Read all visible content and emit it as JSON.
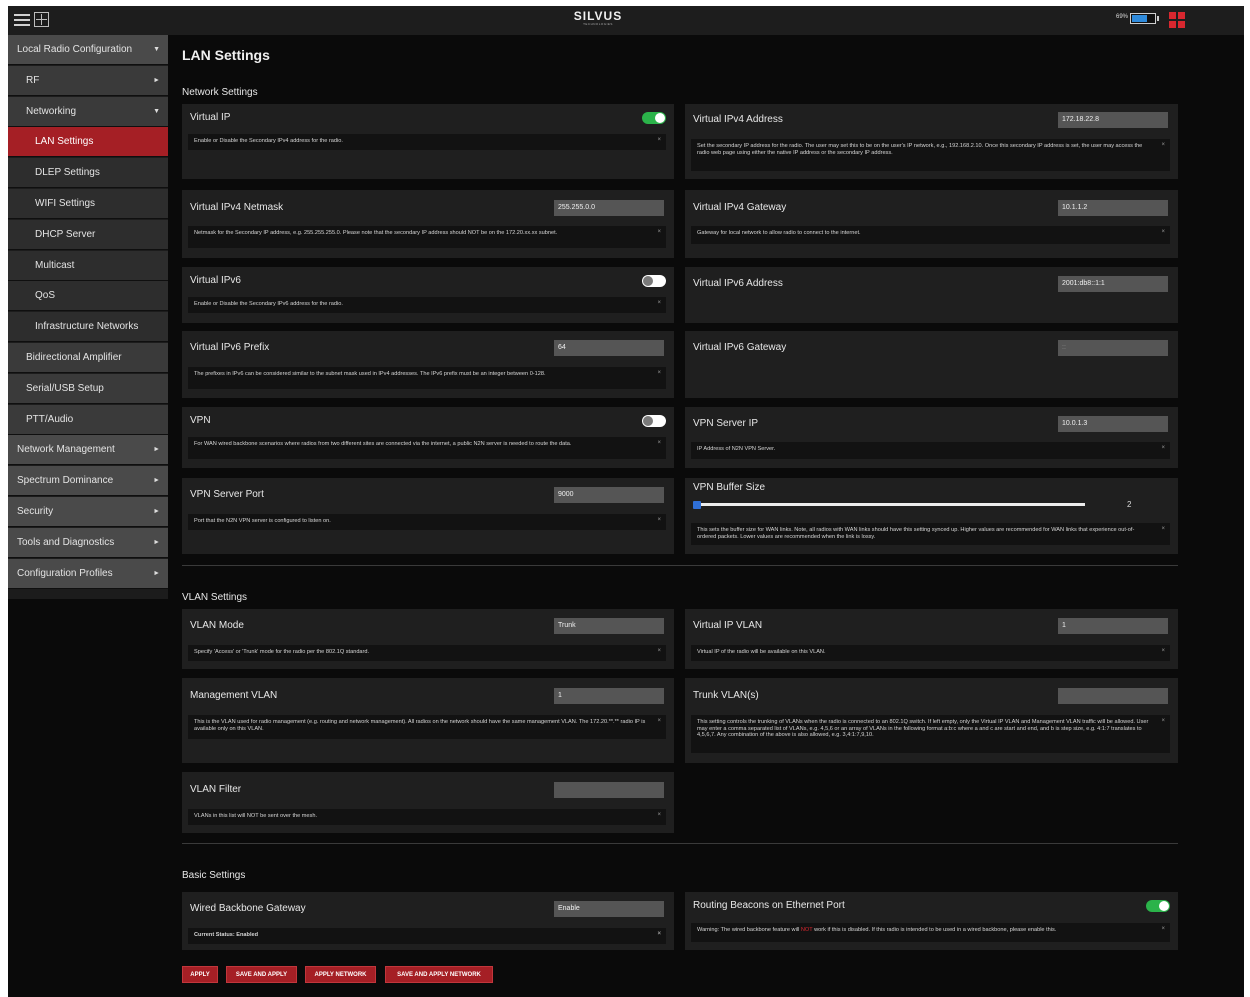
{
  "header": {
    "logo_line1": "SILVUS",
    "logo_line2": "TECHNOLOGIES",
    "battery_percent_label": "69%",
    "battery_level": 0.69,
    "icons": [
      "menu-icon",
      "add-window-icon",
      "battery-icon",
      "grid-icon"
    ]
  },
  "colors": {
    "accent": "#a51f25",
    "toggle_on": "#2bb34a",
    "slider": "#2f6fd6"
  },
  "sidebar": {
    "items": [
      {
        "label": "Local Radio Configuration",
        "level": 0,
        "arrow": "▼"
      },
      {
        "label": "RF",
        "level": 1,
        "arrow": "►"
      },
      {
        "label": "Networking",
        "level": 1,
        "arrow": "▼"
      },
      {
        "label": "LAN Settings",
        "level": 2,
        "active": true
      },
      {
        "label": "DLEP Settings",
        "level": 2
      },
      {
        "label": "WIFI Settings",
        "level": 2
      },
      {
        "label": "DHCP Server",
        "level": 2
      },
      {
        "label": "Multicast",
        "level": 2
      },
      {
        "label": "QoS",
        "level": 2
      },
      {
        "label": "Infrastructure Networks",
        "level": 2
      },
      {
        "label": "Bidirectional Amplifier",
        "level": 1
      },
      {
        "label": "Serial/USB Setup",
        "level": 1
      },
      {
        "label": "PTT/Audio",
        "level": 1
      },
      {
        "label": "Network Management",
        "level": 0,
        "arrow": "►"
      },
      {
        "label": "Spectrum Dominance",
        "level": 0,
        "arrow": "►"
      },
      {
        "label": "Security",
        "level": 0,
        "arrow": "►"
      },
      {
        "label": "Tools and Diagnostics",
        "level": 0,
        "arrow": "►"
      },
      {
        "label": "Configuration Profiles",
        "level": 0,
        "arrow": "►"
      }
    ]
  },
  "page": {
    "title": "LAN Settings",
    "sections": {
      "network": "Network Settings",
      "vlan": "VLAN Settings",
      "basic": "Basic Settings"
    }
  },
  "cards": {
    "virtual_ip": {
      "title": "Virtual IP",
      "toggle_on": true,
      "desc": "Enable or Disable the Secondary IPv4 address for the radio."
    },
    "virtual_ipv4_address": {
      "title": "Virtual IPv4 Address",
      "value": "172.18.22.8",
      "desc": "Set the secondary IP address for the radio. The user may set this to be on the user's IP network, e.g., 192.168.2.10. Once this secondary IP address is set, the user may access the radio web page using either the native IP address or the secondary IP address."
    },
    "virtual_ipv4_netmask": {
      "title": "Virtual IPv4 Netmask",
      "value": "255.255.0.0",
      "desc": "Netmask for the Secondary IP address, e.g. 255.255.255.0. Please note that the secondary IP address should NOT be on the 172.20.xx.xx subnet."
    },
    "virtual_ipv4_gateway": {
      "title": "Virtual IPv4 Gateway",
      "value": "10.1.1.2",
      "desc": "Gateway for local network to allow radio to connect to the internet."
    },
    "virtual_ipv6": {
      "title": "Virtual IPv6",
      "toggle_on": false,
      "desc": "Enable or Disable the Secondary IPv6 address for the radio."
    },
    "virtual_ipv6_address": {
      "title": "Virtual IPv6 Address",
      "value": "2001:db8::1:1"
    },
    "virtual_ipv6_prefix": {
      "title": "Virtual IPv6 Prefix",
      "value": "64",
      "desc": "The prefixes in IPv6 can be considered similar to the subnet mask used in IPv4 addresses. The IPv6 prefix must be an integer between 0-128."
    },
    "virtual_ipv6_gateway": {
      "title": "Virtual IPv6 Gateway",
      "value": "::"
    },
    "vpn": {
      "title": "VPN",
      "toggle_on": false,
      "desc": "For WAN wired backbone scenarios where radios from two different sites are connected via the internet, a public N2N server is needed to route the data."
    },
    "vpn_server_ip": {
      "title": "VPN Server IP",
      "value": "10.0.1.3",
      "desc": "IP Address of N2N VPN Server."
    },
    "vpn_server_port": {
      "title": "VPN Server Port",
      "value": "9000",
      "desc": "Port that the N2N VPN server is configured to listen on."
    },
    "vpn_buffer_size": {
      "title": "VPN Buffer Size",
      "value": "2",
      "slider_fraction": 0.0,
      "desc": "This sets the buffer size for WAN links. Note, all radios with WAN links should have this setting synced up. Higher values are recommended for WAN links that experience out-of-ordered packets. Lower values are recommended when the link is lossy."
    },
    "vlan_mode": {
      "title": "VLAN Mode",
      "value": "Trunk",
      "desc": "Specify 'Access' or 'Trunk' mode for the radio per the 802.1Q standard."
    },
    "virtual_ip_vlan": {
      "title": "Virtual IP VLAN",
      "value": "1",
      "desc": "Virtual IP of the radio will be available on this VLAN."
    },
    "management_vlan": {
      "title": "Management VLAN",
      "value": "1",
      "desc": "This is the VLAN used for radio management (e.g. routing and network management). All radios on the network should have the same management VLAN. The 172.20.**.** radio IP is available only on this VLAN."
    },
    "trunk_vlans": {
      "title": "Trunk VLAN(s)",
      "value": "",
      "desc": "This setting controls the trunking of VLANs when the radio is connected to an 802.1Q switch. If left empty, only the Virtual IP VLAN and Management VLAN traffic will be allowed. User may enter a comma separated list of VLANs, e.g. 4,5,6 or an array of VLANs in the following format a:b:c where a and c are start and end, and b is step size, e.g. 4:1:7 translates to 4,5,6,7. Any combination of the above is also allowed, e.g. 3,4:1:7,9,10."
    },
    "vlan_filter": {
      "title": "VLAN Filter",
      "value": "",
      "desc": "VLANs in this list will NOT be sent over the mesh."
    },
    "wired_backbone_gateway": {
      "title": "Wired Backbone Gateway",
      "value": "Enable",
      "desc": "Current Status: Enabled"
    },
    "routing_beacons": {
      "title": "Routing Beacons on Ethernet Port",
      "toggle_on": true,
      "desc_pre": "Warning: The wired backbone feature will ",
      "desc_red": "NOT",
      "desc_post": " work if this is disabled. If this radio is intended to be used in a wired backbone, please enable this."
    }
  },
  "close_glyph": "×",
  "buttons": {
    "apply": "APPLY",
    "save_and_apply": "SAVE AND APPLY",
    "apply_network": "APPLY NETWORK",
    "save_and_apply_network": "SAVE AND APPLY NETWORK"
  }
}
